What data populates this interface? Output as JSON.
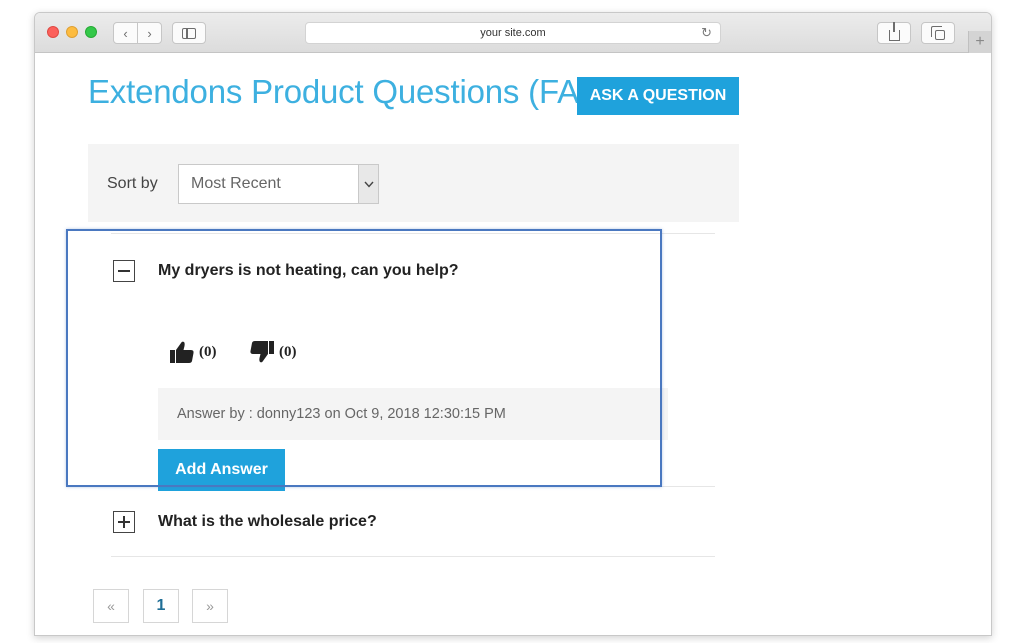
{
  "browser": {
    "address": "your site.com",
    "icons": {
      "back": "chevron-left-icon",
      "forward": "chevron-right-icon",
      "sidebar": "sidebar-icon",
      "reload": "reload-icon",
      "share": "share-icon",
      "tabs": "tabs-icon",
      "new_tab": "plus-icon"
    },
    "back_glyph": "‹",
    "forward_glyph": "›",
    "reload_glyph": "↻",
    "new_tab_glyph": "+"
  },
  "page": {
    "title": "Extendons Product Questions (FAQ)",
    "ask_button": "ASK A QUESTION",
    "accent_color": "#1fa2dc",
    "title_color": "#3db0e0"
  },
  "sort": {
    "label": "Sort by",
    "selected": "Most Recent",
    "arrow_glyph": "⌄"
  },
  "faqs": [
    {
      "question": "My dryers is not heating, can you help?",
      "expanded": true,
      "likes": "(0)",
      "dislikes": "(0)",
      "answer_meta": "Answer by : donny123 on Oct 9, 2018 12:30:15 PM",
      "add_answer_label": "Add Answer"
    },
    {
      "question": "What is the wholesale price?",
      "expanded": false
    }
  ],
  "pagination": {
    "prev": "«",
    "pages": [
      "1"
    ],
    "next": "»"
  },
  "highlight_color": "#4a78c0"
}
